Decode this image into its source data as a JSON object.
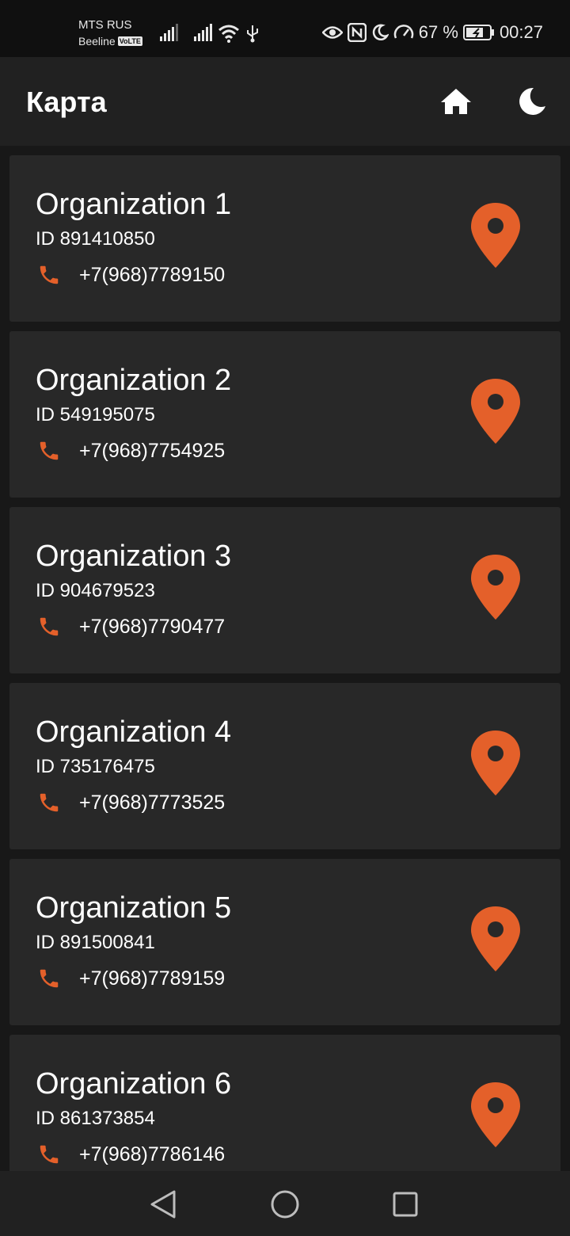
{
  "status_bar": {
    "carrier_1": "MTS RUS",
    "carrier_2": "Beeline",
    "volte_badge": "VoLTE",
    "battery": "67 %",
    "time": "00:27"
  },
  "app_bar": {
    "title": "Карта",
    "home_icon": "home-icon",
    "theme_icon": "moon-icon"
  },
  "colors": {
    "accent": "#e4602a",
    "card_bg": "#282828",
    "app_bar_bg": "#212121",
    "page_bg": "#181818"
  },
  "organizations": [
    {
      "name": "Organization 1",
      "id": "ID 891410850",
      "phone": "+7(968)7789150"
    },
    {
      "name": "Organization 2",
      "id": "ID 549195075",
      "phone": "+7(968)7754925"
    },
    {
      "name": "Organization 3",
      "id": "ID 904679523",
      "phone": "+7(968)7790477"
    },
    {
      "name": "Organization 4",
      "id": "ID 735176475",
      "phone": "+7(968)7773525"
    },
    {
      "name": "Organization 5",
      "id": "ID 891500841",
      "phone": "+7(968)7789159"
    },
    {
      "name": "Organization 6",
      "id": "ID 861373854",
      "phone": "+7(968)7786146"
    }
  ],
  "nav_bar": {
    "back_icon": "back-triangle-icon",
    "home_icon": "home-circle-icon",
    "recents_icon": "recents-square-icon"
  }
}
